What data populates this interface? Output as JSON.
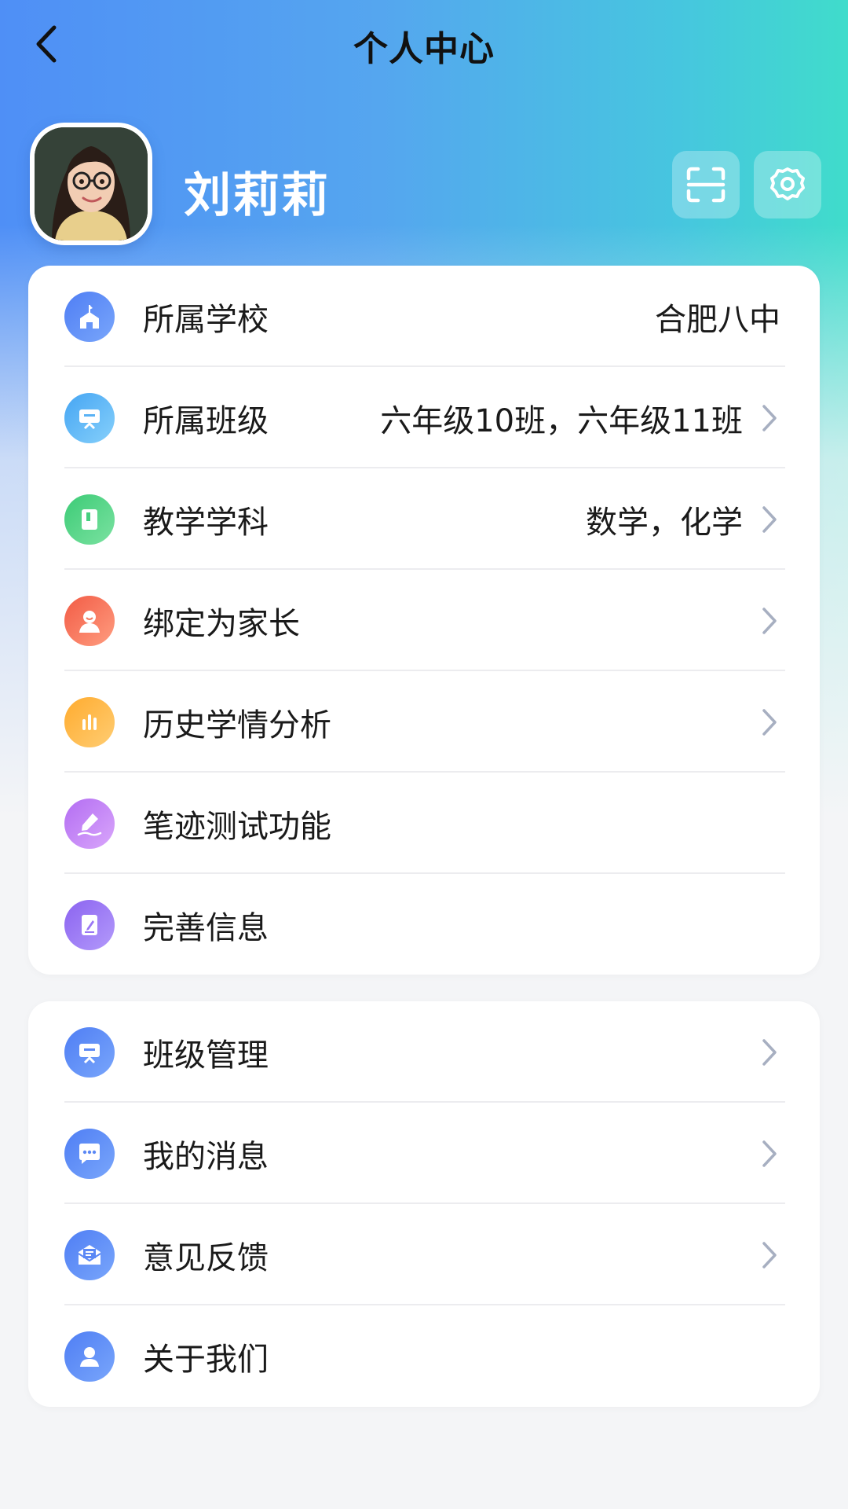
{
  "header": {
    "title": "个人中心"
  },
  "profile": {
    "name": "刘莉莉"
  },
  "colors": {
    "accent_start": "#4f8ff6",
    "accent_end": "#40dccb",
    "chevron": "#a7afc1"
  },
  "card1": {
    "items": [
      {
        "label": "所属学校",
        "value": "合肥八中",
        "icon": "school-icon",
        "chevron": false
      },
      {
        "label": "所属班级",
        "value": "六年级10班，六年级11班",
        "icon": "classroom-icon",
        "chevron": true
      },
      {
        "label": "教学学科",
        "value": "数学，化学",
        "icon": "book-icon",
        "chevron": true
      },
      {
        "label": "绑定为家长",
        "value": "",
        "icon": "parent-icon",
        "chevron": true
      },
      {
        "label": "历史学情分析",
        "value": "",
        "icon": "bar-chart-icon",
        "chevron": true
      },
      {
        "label": "笔迹测试功能",
        "value": "",
        "icon": "pen-icon",
        "chevron": false
      },
      {
        "label": "完善信息",
        "value": "",
        "icon": "edit-document-icon",
        "chevron": false
      }
    ]
  },
  "card2": {
    "items": [
      {
        "label": "班级管理",
        "icon": "classroom-icon",
        "chevron": true
      },
      {
        "label": "我的消息",
        "icon": "message-icon",
        "chevron": true
      },
      {
        "label": "意见反馈",
        "icon": "feedback-mail-icon",
        "chevron": true
      },
      {
        "label": "关于我们",
        "icon": "user-icon",
        "chevron": false
      }
    ]
  }
}
